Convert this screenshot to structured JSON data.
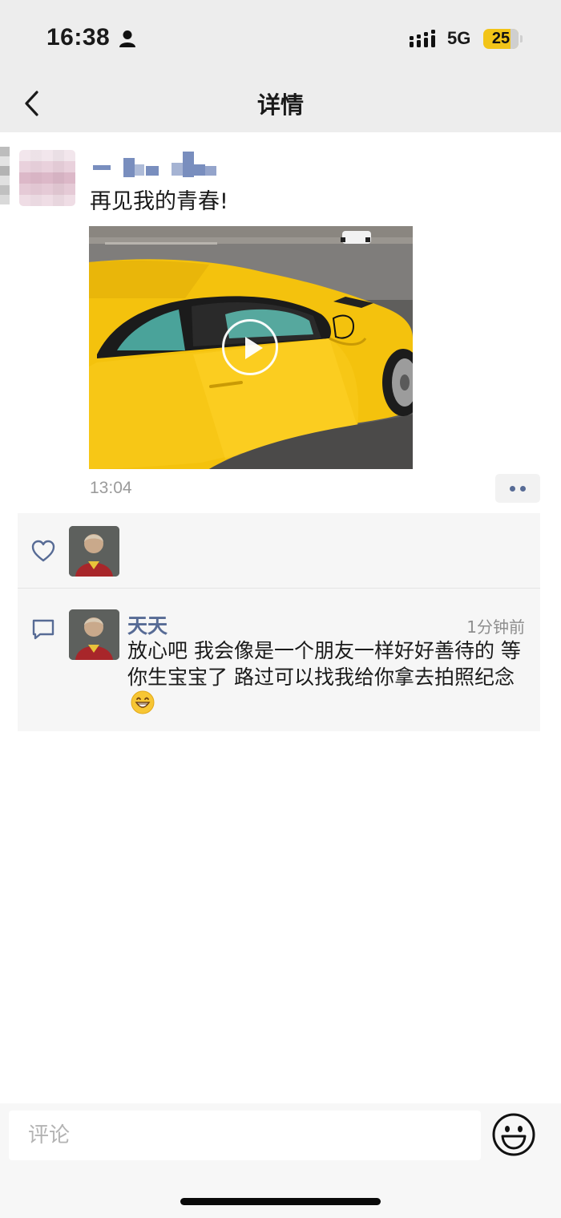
{
  "status_bar": {
    "time": "16:38",
    "network": "5G",
    "battery": "25"
  },
  "nav": {
    "title": "详情"
  },
  "post": {
    "text": "再见我的青春!",
    "time": "13:04"
  },
  "likes": {
    "icon": "heart-icon"
  },
  "comments": [
    {
      "name": "天天",
      "time": "1分钟前",
      "text": "放心吧 我会像是一个朋友一样好好善待的 等你生宝宝了 路过可以找我给你拿去拍照纪念"
    }
  ],
  "input": {
    "placeholder": "评论"
  },
  "colors": {
    "link": "#576b95",
    "car": "#f4c20d"
  }
}
